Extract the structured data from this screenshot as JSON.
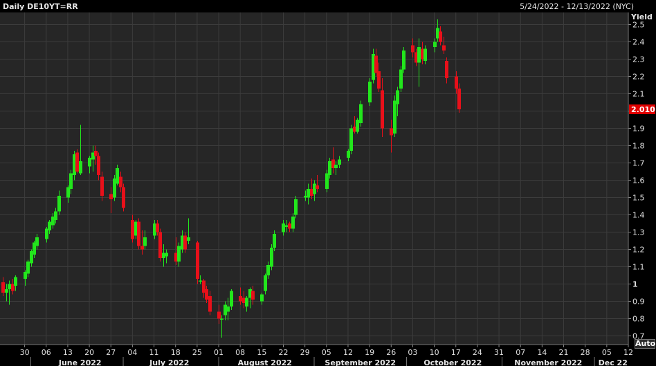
{
  "header": {
    "title": "Daily DE10YT=RR",
    "range": "5/24/2022 - 12/13/2022 (NYC)"
  },
  "controls": {
    "auto_label": "Auto"
  },
  "colors": {
    "background": "#000000",
    "plot_background": "#262626",
    "grid": "#3c3c3c",
    "up": "#22e61c",
    "down": "#e8101a",
    "last_price_tag": "#e00000"
  },
  "chart_data": {
    "type": "candlestick",
    "y_axis": {
      "label": "Yield",
      "range": [
        0.65,
        2.57
      ],
      "ticks": [
        0.7,
        0.8,
        0.9,
        1,
        1.1,
        1.2,
        1.3,
        1.4,
        1.5,
        1.6,
        1.7,
        1.8,
        1.9,
        2.0,
        2.1,
        2.2,
        2.3,
        2.4,
        2.5
      ],
      "tick_labels": [
        "0.7",
        "0.8",
        "0.9",
        "1",
        "1.1",
        "1.2",
        "1.3",
        "1.4",
        "1.5",
        "1.6",
        "1.7",
        "1.8",
        "1.9",
        "2.0",
        "2.1",
        "2.2",
        "2.3",
        "2.4",
        "2.5"
      ],
      "position": "right"
    },
    "last_value": 2.01,
    "last_value_label": "2.010",
    "grid": true,
    "x_axis": {
      "day_range": [
        -2,
        202
      ],
      "day_ticks": [
        {
          "day": 6,
          "label": "30"
        },
        {
          "day": 13,
          "label": "06"
        },
        {
          "day": 20,
          "label": "13"
        },
        {
          "day": 27,
          "label": "20"
        },
        {
          "day": 34,
          "label": "27"
        },
        {
          "day": 41,
          "label": "04"
        },
        {
          "day": 48,
          "label": "11"
        },
        {
          "day": 55,
          "label": "18"
        },
        {
          "day": 62,
          "label": "25"
        },
        {
          "day": 69,
          "label": "01"
        },
        {
          "day": 76,
          "label": "08"
        },
        {
          "day": 83,
          "label": "15"
        },
        {
          "day": 90,
          "label": "22"
        },
        {
          "day": 97,
          "label": "29"
        },
        {
          "day": 104,
          "label": "05"
        },
        {
          "day": 111,
          "label": "12"
        },
        {
          "day": 118,
          "label": "19"
        },
        {
          "day": 125,
          "label": "26"
        },
        {
          "day": 132,
          "label": "03"
        },
        {
          "day": 139,
          "label": "10"
        },
        {
          "day": 146,
          "label": "17"
        },
        {
          "day": 153,
          "label": "24"
        },
        {
          "day": 160,
          "label": "31"
        },
        {
          "day": 167,
          "label": "07"
        },
        {
          "day": 174,
          "label": "14"
        },
        {
          "day": 181,
          "label": "21"
        },
        {
          "day": 188,
          "label": "28"
        },
        {
          "day": 195,
          "label": "05"
        },
        {
          "day": 202,
          "label": "12"
        }
      ],
      "month_boundaries": [
        8,
        38,
        69,
        100,
        130,
        161,
        191
      ],
      "months": [
        {
          "day": 24,
          "label": "June 2022"
        },
        {
          "day": 53,
          "label": "July 2022"
        },
        {
          "day": 84,
          "label": "August 2022"
        },
        {
          "day": 115,
          "label": "September 2022"
        },
        {
          "day": 145,
          "label": "October 2022"
        },
        {
          "day": 176,
          "label": "November 2022"
        },
        {
          "day": 197,
          "label": "Dec 22"
        }
      ]
    },
    "candles": [
      {
        "d": -1,
        "o": 1.01,
        "h": 1.04,
        "l": 0.93,
        "c": 0.95
      },
      {
        "d": 0,
        "o": 0.95,
        "h": 1.0,
        "l": 0.9,
        "c": 0.97
      },
      {
        "d": 1,
        "o": 0.97,
        "h": 1.02,
        "l": 0.88,
        "c": 1.0
      },
      {
        "d": 2,
        "o": 1.0,
        "h": 1.03,
        "l": 0.94,
        "c": 0.96
      },
      {
        "d": 3,
        "o": 0.99,
        "h": 1.05,
        "l": 0.96,
        "c": 1.04
      },
      {
        "d": 6,
        "o": 1.03,
        "h": 1.08,
        "l": 0.99,
        "c": 1.07
      },
      {
        "d": 7,
        "o": 1.06,
        "h": 1.14,
        "l": 1.04,
        "c": 1.13
      },
      {
        "d": 8,
        "o": 1.12,
        "h": 1.2,
        "l": 1.1,
        "c": 1.19
      },
      {
        "d": 9,
        "o": 1.17,
        "h": 1.25,
        "l": 1.15,
        "c": 1.24
      },
      {
        "d": 10,
        "o": 1.22,
        "h": 1.29,
        "l": 1.2,
        "c": 1.27
      },
      {
        "d": 13,
        "o": 1.26,
        "h": 1.33,
        "l": 1.24,
        "c": 1.32
      },
      {
        "d": 14,
        "o": 1.31,
        "h": 1.37,
        "l": 1.29,
        "c": 1.36
      },
      {
        "d": 15,
        "o": 1.34,
        "h": 1.41,
        "l": 1.32,
        "c": 1.39
      },
      {
        "d": 16,
        "o": 1.37,
        "h": 1.44,
        "l": 1.35,
        "c": 1.42
      },
      {
        "d": 17,
        "o": 1.42,
        "h": 1.54,
        "l": 1.4,
        "c": 1.51
      },
      {
        "d": 20,
        "o": 1.5,
        "h": 1.57,
        "l": 1.47,
        "c": 1.56
      },
      {
        "d": 21,
        "o": 1.55,
        "h": 1.66,
        "l": 1.52,
        "c": 1.64
      },
      {
        "d": 22,
        "o": 1.63,
        "h": 1.77,
        "l": 1.6,
        "c": 1.75
      },
      {
        "d": 23,
        "o": 1.76,
        "h": 1.78,
        "l": 1.64,
        "c": 1.65
      },
      {
        "d": 24,
        "o": 1.64,
        "h": 1.92,
        "l": 1.63,
        "c": 1.71
      },
      {
        "d": 27,
        "o": 1.68,
        "h": 1.74,
        "l": 1.64,
        "c": 1.73
      },
      {
        "d": 28,
        "o": 1.72,
        "h": 1.8,
        "l": 1.65,
        "c": 1.76
      },
      {
        "d": 29,
        "o": 1.77,
        "h": 1.8,
        "l": 1.69,
        "c": 1.74
      },
      {
        "d": 30,
        "o": 1.74,
        "h": 1.76,
        "l": 1.6,
        "c": 1.63
      },
      {
        "d": 31,
        "o": 1.62,
        "h": 1.65,
        "l": 1.48,
        "c": 1.51
      },
      {
        "d": 34,
        "o": 1.52,
        "h": 1.56,
        "l": 1.41,
        "c": 1.49
      },
      {
        "d": 35,
        "o": 1.5,
        "h": 1.63,
        "l": 1.48,
        "c": 1.61
      },
      {
        "d": 36,
        "o": 1.58,
        "h": 1.69,
        "l": 1.57,
        "c": 1.67
      },
      {
        "d": 37,
        "o": 1.62,
        "h": 1.65,
        "l": 1.53,
        "c": 1.56
      },
      {
        "d": 38,
        "o": 1.56,
        "h": 1.58,
        "l": 1.42,
        "c": 1.44
      },
      {
        "d": 41,
        "o": 1.37,
        "h": 1.4,
        "l": 1.24,
        "c": 1.26
      },
      {
        "d": 42,
        "o": 1.28,
        "h": 1.37,
        "l": 1.26,
        "c": 1.36
      },
      {
        "d": 43,
        "o": 1.36,
        "h": 1.38,
        "l": 1.2,
        "c": 1.22
      },
      {
        "d": 44,
        "o": 1.22,
        "h": 1.31,
        "l": 1.17,
        "c": 1.2
      },
      {
        "d": 45,
        "o": 1.22,
        "h": 1.31,
        "l": 1.2,
        "c": 1.27
      },
      {
        "d": 48,
        "o": 1.28,
        "h": 1.37,
        "l": 1.26,
        "c": 1.35
      },
      {
        "d": 49,
        "o": 1.35,
        "h": 1.37,
        "l": 1.28,
        "c": 1.3
      },
      {
        "d": 50,
        "o": 1.3,
        "h": 1.32,
        "l": 1.13,
        "c": 1.15
      },
      {
        "d": 51,
        "o": 1.15,
        "h": 1.23,
        "l": 1.1,
        "c": 1.18
      },
      {
        "d": 52,
        "o": 1.16,
        "h": 1.2,
        "l": 1.12,
        "c": 1.18
      },
      {
        "d": 55,
        "o": 1.18,
        "h": 1.27,
        "l": 1.11,
        "c": 1.13
      },
      {
        "d": 56,
        "o": 1.13,
        "h": 1.24,
        "l": 1.1,
        "c": 1.22
      },
      {
        "d": 57,
        "o": 1.2,
        "h": 1.31,
        "l": 1.18,
        "c": 1.28
      },
      {
        "d": 58,
        "o": 1.28,
        "h": 1.3,
        "l": 1.18,
        "c": 1.2
      },
      {
        "d": 59,
        "o": 1.25,
        "h": 1.38,
        "l": 1.23,
        "c": 1.27
      },
      {
        "d": 62,
        "o": 1.24,
        "h": 1.25,
        "l": 1.0,
        "c": 1.03
      },
      {
        "d": 63,
        "o": 1.02,
        "h": 1.05,
        "l": 1.0,
        "c": 1.02
      },
      {
        "d": 64,
        "o": 1.02,
        "h": 1.03,
        "l": 0.92,
        "c": 0.95
      },
      {
        "d": 65,
        "o": 0.97,
        "h": 0.99,
        "l": 0.89,
        "c": 0.91
      },
      {
        "d": 66,
        "o": 0.93,
        "h": 0.96,
        "l": 0.82,
        "c": 0.84
      },
      {
        "d": 69,
        "o": 0.84,
        "h": 0.88,
        "l": 0.77,
        "c": 0.8
      },
      {
        "d": 70,
        "o": 0.8,
        "h": 0.82,
        "l": 0.69,
        "c": 0.8
      },
      {
        "d": 71,
        "o": 0.82,
        "h": 0.9,
        "l": 0.79,
        "c": 0.88
      },
      {
        "d": 72,
        "o": 0.84,
        "h": 0.92,
        "l": 0.79,
        "c": 0.87
      },
      {
        "d": 73,
        "o": 0.87,
        "h": 0.97,
        "l": 0.85,
        "c": 0.96
      },
      {
        "d": 76,
        "o": 0.93,
        "h": 0.98,
        "l": 0.88,
        "c": 0.9
      },
      {
        "d": 77,
        "o": 0.92,
        "h": 0.96,
        "l": 0.86,
        "c": 0.89
      },
      {
        "d": 78,
        "o": 0.87,
        "h": 0.93,
        "l": 0.84,
        "c": 0.92
      },
      {
        "d": 79,
        "o": 0.92,
        "h": 0.98,
        "l": 0.86,
        "c": 0.97
      },
      {
        "d": 80,
        "o": 0.96,
        "h": 0.99,
        "l": 0.88,
        "c": 0.91
      },
      {
        "d": 83,
        "o": 0.9,
        "h": 0.95,
        "l": 0.88,
        "c": 0.94
      },
      {
        "d": 84,
        "o": 0.96,
        "h": 1.06,
        "l": 0.94,
        "c": 1.05
      },
      {
        "d": 85,
        "o": 1.05,
        "h": 1.13,
        "l": 1.03,
        "c": 1.11
      },
      {
        "d": 86,
        "o": 1.1,
        "h": 1.23,
        "l": 1.08,
        "c": 1.21
      },
      {
        "d": 87,
        "o": 1.21,
        "h": 1.31,
        "l": 1.19,
        "c": 1.29
      },
      {
        "d": 90,
        "o": 1.3,
        "h": 1.37,
        "l": 1.28,
        "c": 1.35
      },
      {
        "d": 91,
        "o": 1.33,
        "h": 1.37,
        "l": 1.3,
        "c": 1.34
      },
      {
        "d": 92,
        "o": 1.35,
        "h": 1.36,
        "l": 1.3,
        "c": 1.32
      },
      {
        "d": 93,
        "o": 1.32,
        "h": 1.41,
        "l": 1.3,
        "c": 1.39
      },
      {
        "d": 94,
        "o": 1.4,
        "h": 1.51,
        "l": 1.38,
        "c": 1.49
      },
      {
        "d": 97,
        "o": 1.5,
        "h": 1.54,
        "l": 1.48,
        "c": 1.51
      },
      {
        "d": 98,
        "o": 1.5,
        "h": 1.58,
        "l": 1.46,
        "c": 1.55
      },
      {
        "d": 99,
        "o": 1.55,
        "h": 1.61,
        "l": 1.49,
        "c": 1.51
      },
      {
        "d": 100,
        "o": 1.52,
        "h": 1.6,
        "l": 1.48,
        "c": 1.58
      },
      {
        "d": 101,
        "o": 1.57,
        "h": 1.63,
        "l": 1.53,
        "c": 1.55
      },
      {
        "d": 104,
        "o": 1.55,
        "h": 1.66,
        "l": 1.53,
        "c": 1.64
      },
      {
        "d": 105,
        "o": 1.63,
        "h": 1.73,
        "l": 1.61,
        "c": 1.71
      },
      {
        "d": 106,
        "o": 1.72,
        "h": 1.79,
        "l": 1.64,
        "c": 1.67
      },
      {
        "d": 107,
        "o": 1.67,
        "h": 1.71,
        "l": 1.63,
        "c": 1.69
      },
      {
        "d": 108,
        "o": 1.69,
        "h": 1.74,
        "l": 1.67,
        "c": 1.72
      },
      {
        "d": 111,
        "o": 1.73,
        "h": 1.78,
        "l": 1.71,
        "c": 1.77
      },
      {
        "d": 112,
        "o": 1.77,
        "h": 1.92,
        "l": 1.75,
        "c": 1.9
      },
      {
        "d": 113,
        "o": 1.91,
        "h": 1.97,
        "l": 1.87,
        "c": 1.88
      },
      {
        "d": 114,
        "o": 1.88,
        "h": 1.96,
        "l": 1.87,
        "c": 1.95
      },
      {
        "d": 115,
        "o": 1.93,
        "h": 2.06,
        "l": 1.91,
        "c": 2.04
      },
      {
        "d": 118,
        "o": 2.05,
        "h": 2.19,
        "l": 2.03,
        "c": 2.17
      },
      {
        "d": 119,
        "o": 2.18,
        "h": 2.36,
        "l": 2.16,
        "c": 2.33
      },
      {
        "d": 120,
        "o": 2.32,
        "h": 2.36,
        "l": 2.2,
        "c": 2.22
      },
      {
        "d": 121,
        "o": 2.23,
        "h": 2.28,
        "l": 2.11,
        "c": 2.13
      },
      {
        "d": 122,
        "o": 2.12,
        "h": 2.19,
        "l": 1.85,
        "c": 1.9
      },
      {
        "d": 125,
        "o": 1.9,
        "h": 1.95,
        "l": 1.76,
        "c": 1.86
      },
      {
        "d": 126,
        "o": 1.87,
        "h": 2.09,
        "l": 1.85,
        "c": 2.06
      },
      {
        "d": 127,
        "o": 2.04,
        "h": 2.14,
        "l": 1.97,
        "c": 2.12
      },
      {
        "d": 128,
        "o": 2.13,
        "h": 2.26,
        "l": 2.11,
        "c": 2.24
      },
      {
        "d": 129,
        "o": 2.24,
        "h": 2.37,
        "l": 2.22,
        "c": 2.35
      },
      {
        "d": 132,
        "o": 2.38,
        "h": 2.42,
        "l": 2.31,
        "c": 2.34
      },
      {
        "d": 133,
        "o": 2.34,
        "h": 2.36,
        "l": 2.26,
        "c": 2.28
      },
      {
        "d": 134,
        "o": 2.28,
        "h": 2.42,
        "l": 2.14,
        "c": 2.37
      },
      {
        "d": 135,
        "o": 2.36,
        "h": 2.4,
        "l": 2.27,
        "c": 2.3
      },
      {
        "d": 136,
        "o": 2.29,
        "h": 2.38,
        "l": 2.27,
        "c": 2.36
      },
      {
        "d": 139,
        "o": 2.37,
        "h": 2.42,
        "l": 2.34,
        "c": 2.4
      },
      {
        "d": 140,
        "o": 2.42,
        "h": 2.53,
        "l": 2.4,
        "c": 2.48
      },
      {
        "d": 141,
        "o": 2.46,
        "h": 2.49,
        "l": 2.38,
        "c": 2.4
      },
      {
        "d": 142,
        "o": 2.38,
        "h": 2.43,
        "l": 2.33,
        "c": 2.35
      },
      {
        "d": 143,
        "o": 2.29,
        "h": 2.31,
        "l": 2.16,
        "c": 2.19
      },
      {
        "d": 146,
        "o": 2.2,
        "h": 2.23,
        "l": 2.1,
        "c": 2.13
      },
      {
        "d": 147,
        "o": 2.13,
        "h": 2.16,
        "l": 1.99,
        "c": 2.01
      }
    ]
  }
}
